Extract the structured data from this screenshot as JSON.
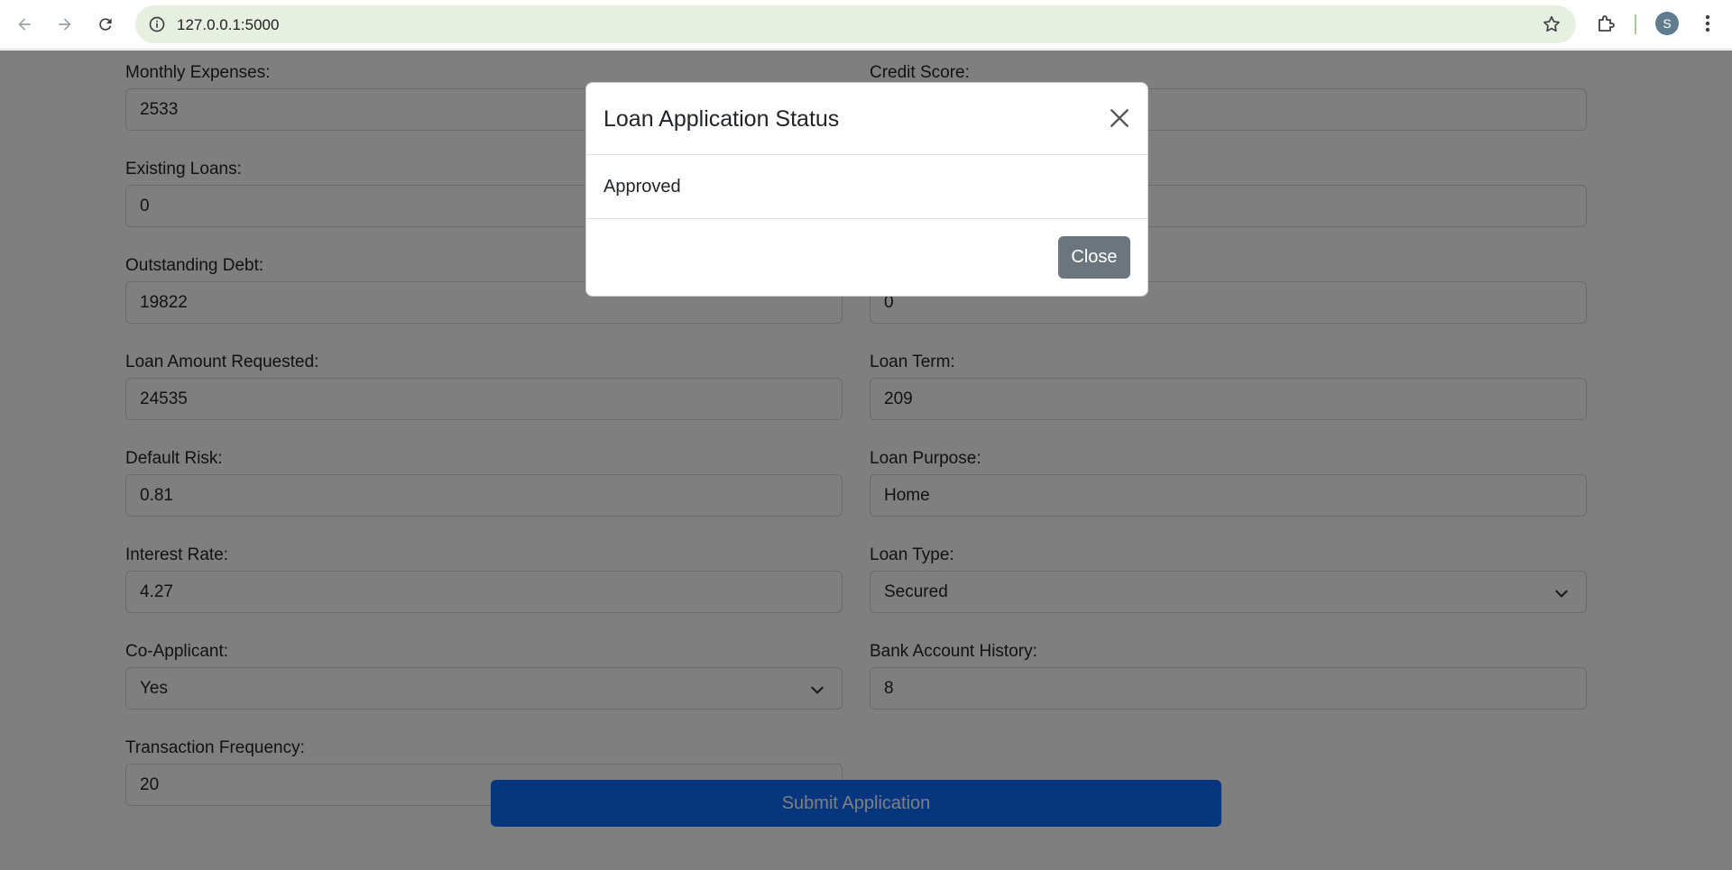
{
  "browser": {
    "url": "127.0.0.1:5000",
    "profile_initial": "S"
  },
  "form": {
    "left": [
      {
        "label": "Monthly Expenses:",
        "value": "2533"
      },
      {
        "label": "Existing Loans:",
        "value": "0"
      },
      {
        "label": "Outstanding Debt:",
        "value": "19822"
      },
      {
        "label": "Loan Amount Requested:",
        "value": "24535"
      },
      {
        "label": "Default Risk:",
        "value": "0.81"
      },
      {
        "label": "Interest Rate:",
        "value": "4.27"
      },
      {
        "label": "Co-Applicant:",
        "value": "Yes"
      },
      {
        "label": "Transaction Frequency:",
        "value": "20"
      }
    ],
    "right": [
      {
        "label": "Credit Score:",
        "value": ""
      },
      {
        "label": "",
        "value": ""
      },
      {
        "label": "",
        "value": "0"
      },
      {
        "label": "Loan Term:",
        "value": "209"
      },
      {
        "label": "Loan Purpose:",
        "value": "Home"
      },
      {
        "label": "Loan Type:",
        "value": "Secured"
      },
      {
        "label": "Bank Account History:",
        "value": "8"
      }
    ],
    "submit_label": "Submit Application"
  },
  "modal": {
    "title": "Loan Application Status",
    "message": "Approved",
    "close_label": "Close"
  }
}
